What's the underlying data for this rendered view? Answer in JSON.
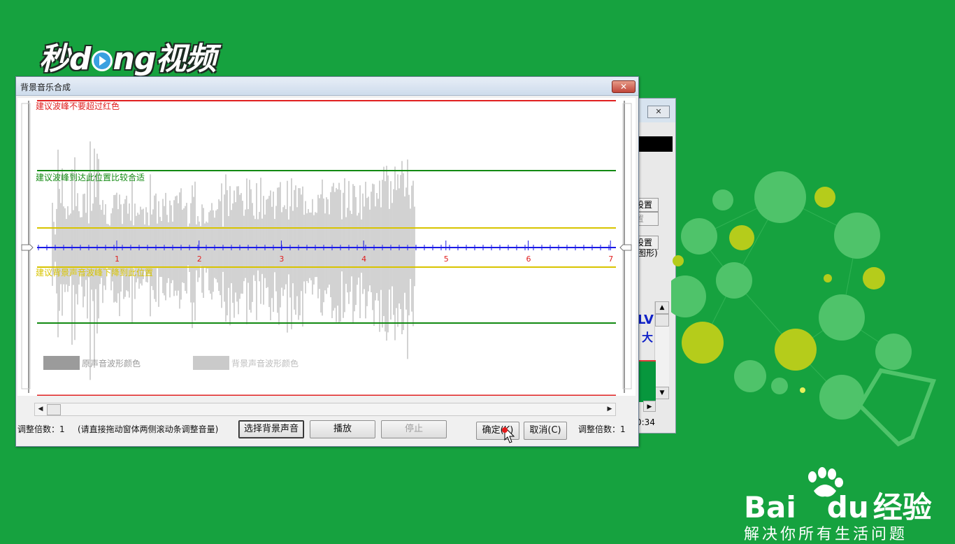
{
  "logo": {
    "text_a": "秒",
    "text_b": "d",
    "text_c": "ng视频"
  },
  "dialog": {
    "title": "背景音乐合成",
    "close_label": "✕",
    "labels": {
      "red": "建议波峰不要超过红色",
      "green": "建议波峰到达此位置比较合适",
      "yellow": "建议背景声音波峰下降到此位置"
    },
    "time_ticks": [
      "1",
      "2",
      "3",
      "4",
      "5",
      "6",
      "7"
    ],
    "legend": {
      "original": "原声音波形颜色",
      "background": "背景声音波形颜色"
    },
    "left_factor": "调整倍数：1",
    "hint": "(请直接拖动窗体两侧滚动条调整音量)",
    "buttons": {
      "select": "选择背景声音",
      "play": "播放",
      "stop": "停止",
      "ok": "确定(K)",
      "cancel": "取消(C)"
    },
    "right_factor": "调整倍数：1",
    "colors": {
      "red": "#e02020",
      "green": "#128a12",
      "yellow": "#d8c400",
      "blue": "#1a1ae6",
      "wave": "#c4c4c4",
      "legend_dark": "#9b9b9b",
      "legend_light": "#cacaca"
    }
  },
  "bg_window": {
    "close_label": "✕",
    "btn1": "设置",
    "btn2": "置",
    "btn3": "设置",
    "txt_shape": "图形)",
    "lv": "LV",
    "da": "大",
    "time": "0:34"
  },
  "baidu": {
    "brand": "Bai",
    "du": "du",
    "jingyan": "经验",
    "slogan": "解决你所有生活问题"
  }
}
